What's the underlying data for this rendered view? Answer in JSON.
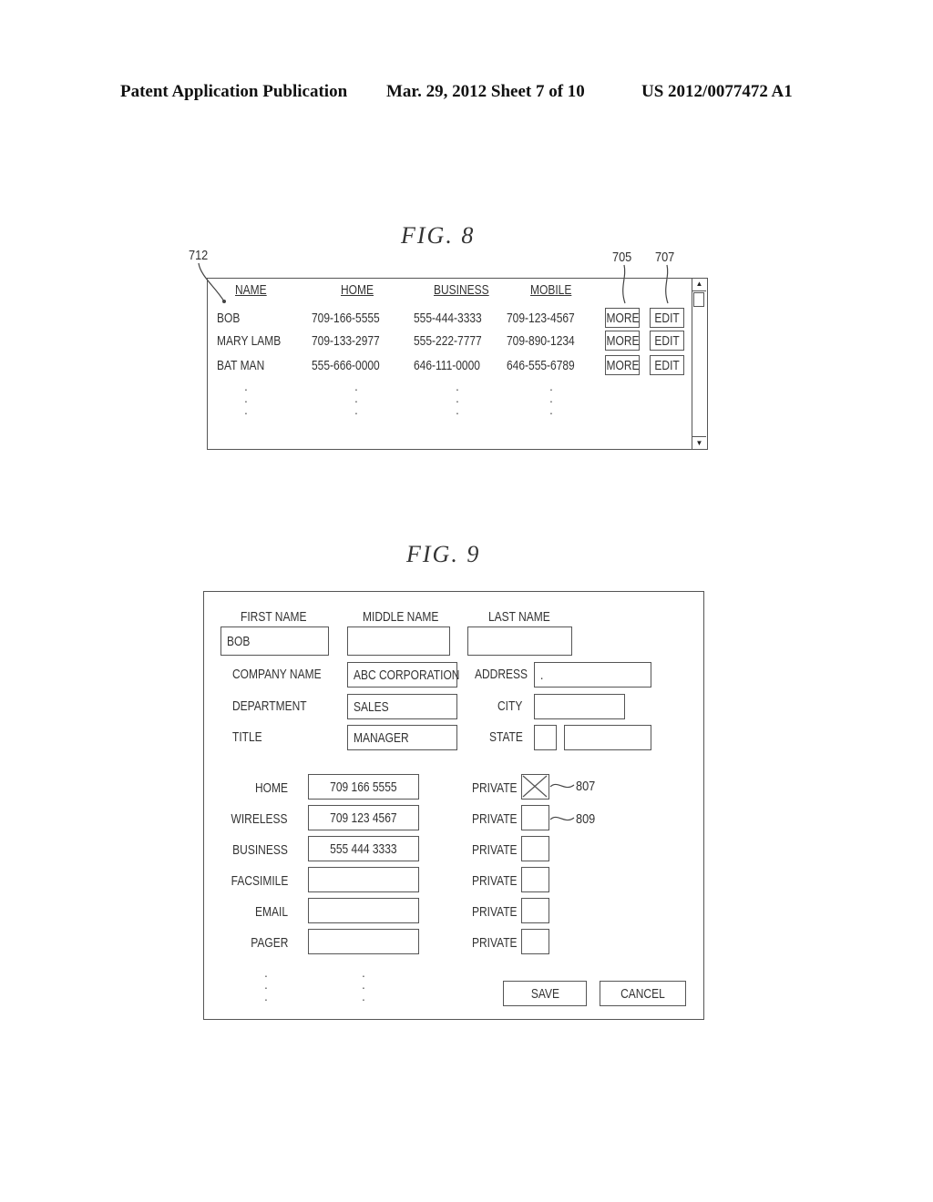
{
  "header": {
    "publication": "Patent Application Publication",
    "date_sheet": "Mar. 29, 2012  Sheet 7 of 10",
    "patent_number": "US 2012/0077472 A1"
  },
  "fig8": {
    "title": "FIG. 8",
    "refs": {
      "list": "712",
      "more": "705",
      "edit": "707"
    },
    "columns": [
      "NAME",
      "HOME",
      "BUSINESS",
      "MOBILE"
    ],
    "rows": [
      {
        "name": "BOB",
        "home": "709-166-5555",
        "business": "555-444-3333",
        "mobile": "709-123-4567",
        "more": "MORE",
        "edit": "EDIT"
      },
      {
        "name": "MARY LAMB",
        "home": "709-133-2977",
        "business": "555-222-7777",
        "mobile": "709-890-1234",
        "more": "MORE",
        "edit": "EDIT"
      },
      {
        "name": "BAT MAN",
        "home": "555-666-0000",
        "business": "646-111-0000",
        "mobile": "646-555-6789",
        "more": "MORE",
        "edit": "EDIT"
      }
    ],
    "continuation": ".\n.\n.",
    "scrollbar": {
      "up": "▲",
      "down": "▼"
    }
  },
  "fig9": {
    "title": "FIG. 9",
    "name_fields": [
      {
        "label": "FIRST NAME",
        "value": "BOB"
      },
      {
        "label": "MIDDLE NAME",
        "value": ""
      },
      {
        "label": "LAST NAME",
        "value": ""
      }
    ],
    "left_fields": [
      {
        "label": "COMPANY NAME",
        "value": "ABC CORPORATION"
      },
      {
        "label": "DEPARTMENT",
        "value": "SALES"
      },
      {
        "label": "TITLE",
        "value": "MANAGER"
      }
    ],
    "right_fields": [
      {
        "label": "ADDRESS",
        "value": "."
      },
      {
        "label": "CITY",
        "value": ""
      },
      {
        "label": "STATE",
        "value": "",
        "value2": ""
      }
    ],
    "phone_fields": [
      {
        "label": "HOME",
        "value": "709 166 5555",
        "private_label": "PRIVATE",
        "private_checked": true
      },
      {
        "label": "WIRELESS",
        "value": "709 123 4567",
        "private_label": "PRIVATE",
        "private_checked": false
      },
      {
        "label": "BUSINESS",
        "value": "555 444 3333",
        "private_label": "PRIVATE",
        "private_checked": false
      },
      {
        "label": "FACSIMILE",
        "value": "",
        "private_label": "PRIVATE",
        "private_checked": false
      },
      {
        "label": "EMAIL",
        "value": "",
        "private_label": "PRIVATE",
        "private_checked": false
      },
      {
        "label": "PAGER",
        "value": "",
        "private_label": "PRIVATE",
        "private_checked": false
      }
    ],
    "refs": {
      "checked_box": "807",
      "unchecked_box": "809"
    },
    "continuation": ".\n.\n.",
    "buttons": {
      "save": "SAVE",
      "cancel": "CANCEL"
    }
  }
}
